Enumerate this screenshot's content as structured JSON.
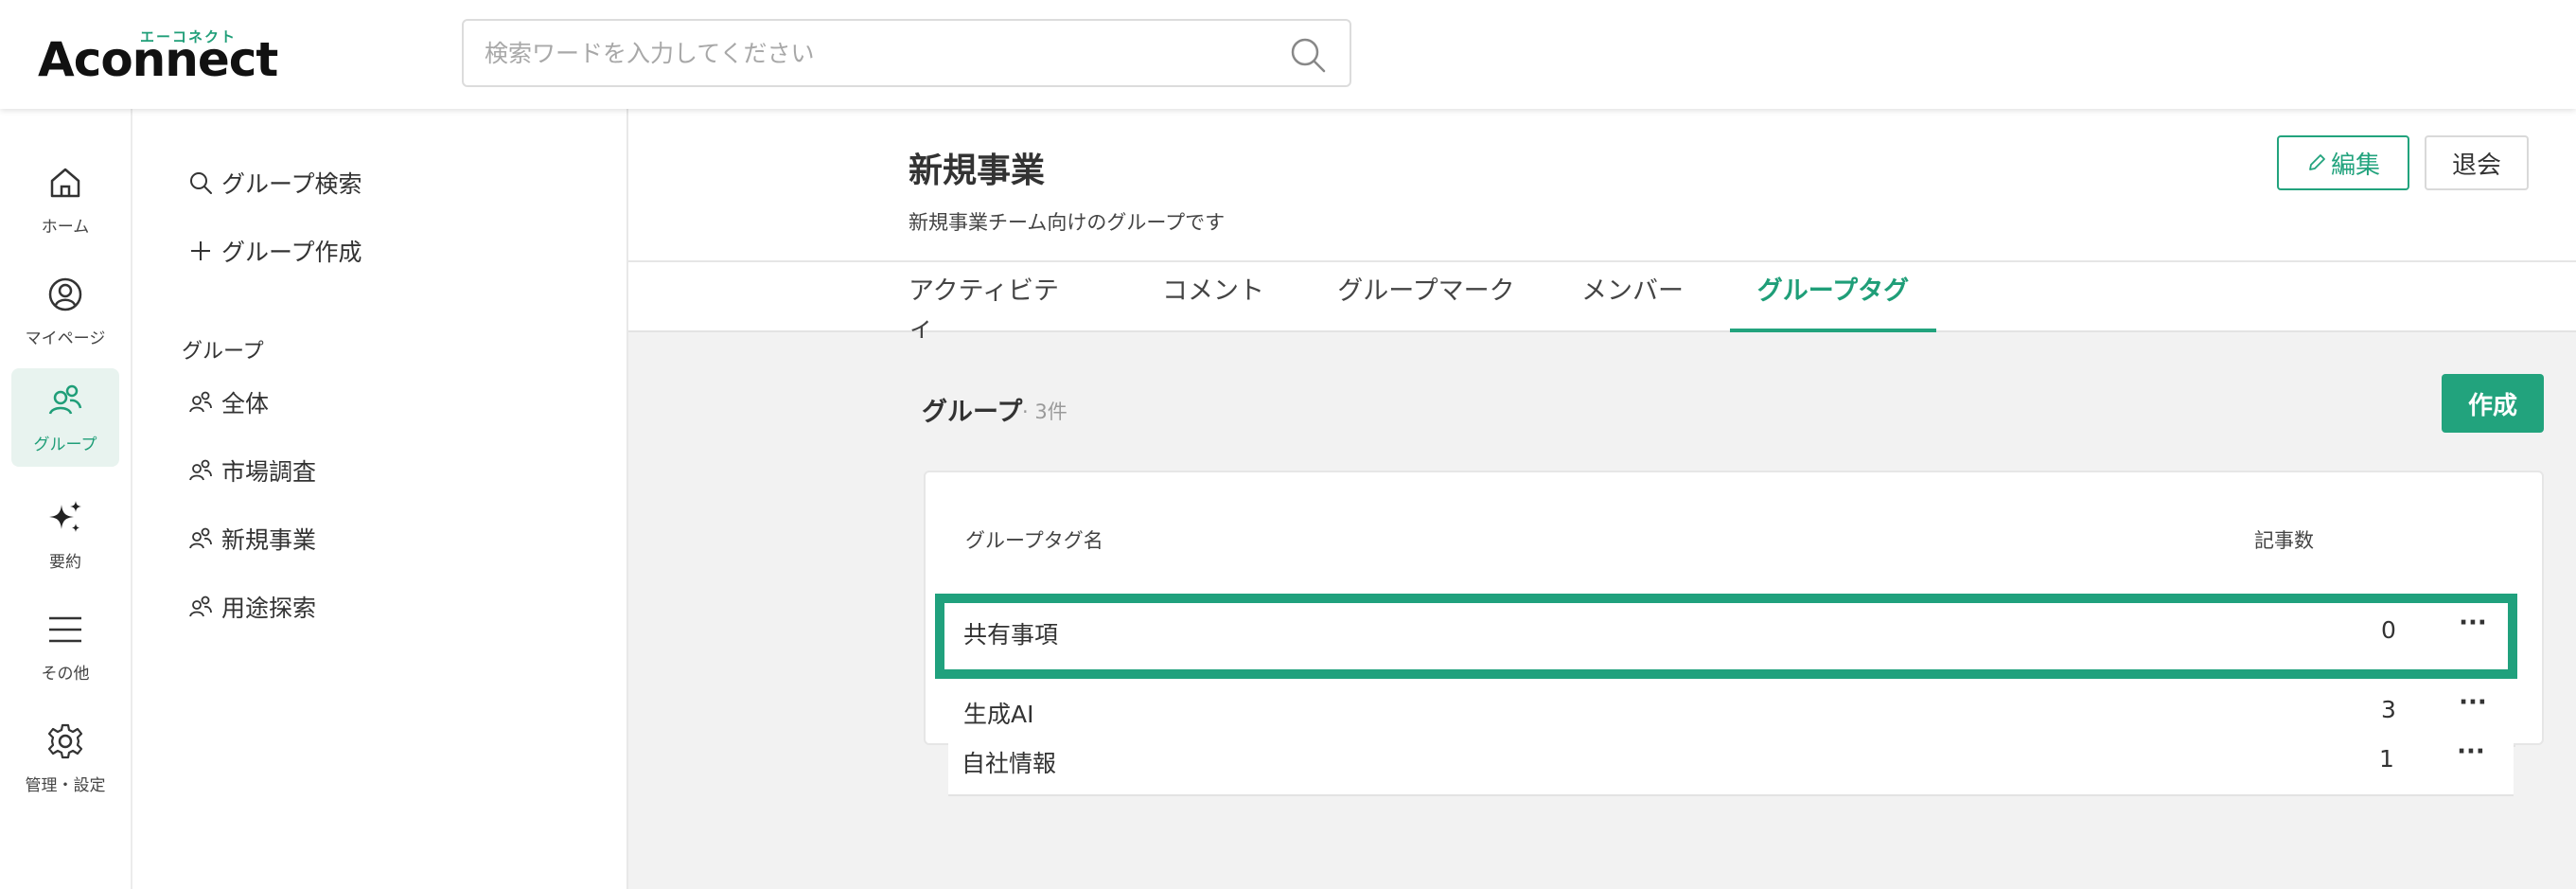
{
  "app": {
    "logo_kana": "エーコネクト",
    "logo_text": "Aconnect",
    "brand_color": "#22a37d"
  },
  "search": {
    "placeholder": "検索ワードを入力してください",
    "value": ""
  },
  "rail": {
    "items": [
      {
        "label": "ホーム",
        "icon": "home-icon"
      },
      {
        "label": "マイページ",
        "icon": "user-circle-icon"
      },
      {
        "label": "グループ",
        "icon": "group-icon"
      },
      {
        "label": "要約",
        "icon": "sparkle-icon"
      },
      {
        "label": "その他",
        "icon": "menu-icon"
      },
      {
        "label": "管理・設定",
        "icon": "gear-icon"
      }
    ],
    "active": "グループ"
  },
  "groupnav": {
    "search_label": "グループ検索",
    "create_label": "グループ作成",
    "section_label": "グループ",
    "groups": [
      "全体",
      "市場調査",
      "新規事業",
      "用途探索"
    ]
  },
  "group": {
    "title": "新規事業",
    "description": "新規事業チーム向けのグループです",
    "edit_label": "編集",
    "leave_label": "退会"
  },
  "tabs": [
    {
      "label": "アクティビティ"
    },
    {
      "label": "コメント"
    },
    {
      "label": "グループマーク"
    },
    {
      "label": "メンバー"
    },
    {
      "label": "グループタグ"
    }
  ],
  "active_tab": "グループタグ",
  "tag_list": {
    "title": "グループ",
    "count_label": "· 3件",
    "create_label": "作成",
    "col_name": "グループタグ名",
    "col_count": "記事数",
    "rows": [
      {
        "name": "共有事項",
        "count": "0",
        "more": "···",
        "highlighted": true
      },
      {
        "name": "生成AI",
        "count": "3",
        "more": "···"
      },
      {
        "name": "自社情報",
        "count": "1",
        "more": "···"
      }
    ]
  }
}
